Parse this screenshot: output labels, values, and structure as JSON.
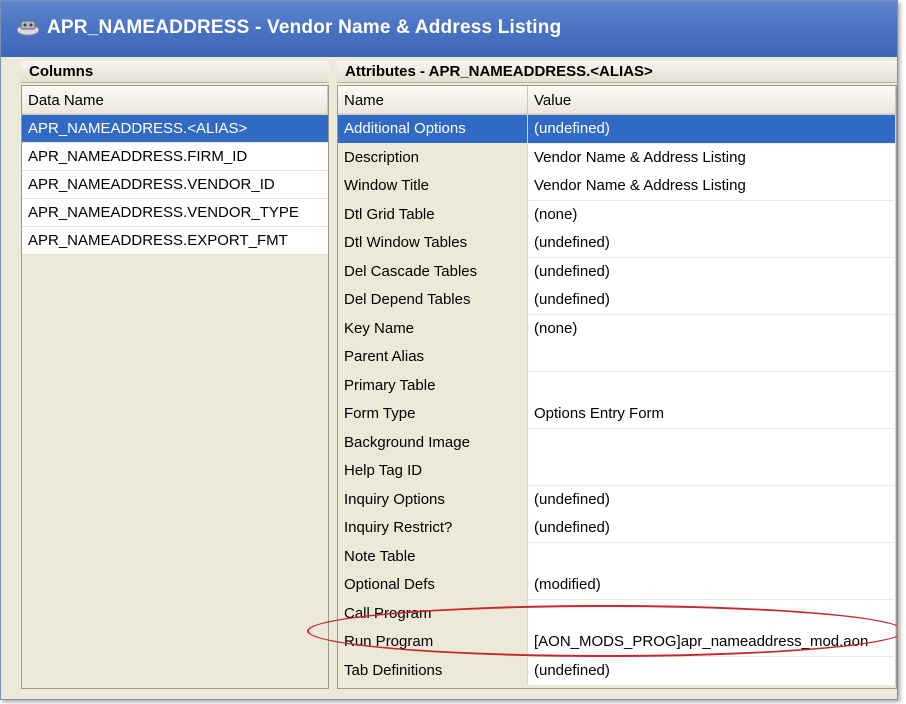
{
  "window": {
    "title": "APR_NAMEADDRESS - Vendor Name & Address Listing",
    "icon": "app-icon"
  },
  "columns_pane": {
    "header": "Columns",
    "column_header": "Data Name",
    "items": [
      {
        "label": "APR_NAMEADDRESS.<ALIAS>",
        "selected": true
      },
      {
        "label": "APR_NAMEADDRESS.FIRM_ID",
        "selected": false
      },
      {
        "label": "APR_NAMEADDRESS.VENDOR_ID",
        "selected": false
      },
      {
        "label": "APR_NAMEADDRESS.VENDOR_TYPE",
        "selected": false
      },
      {
        "label": "APR_NAMEADDRESS.EXPORT_FMT",
        "selected": false
      }
    ]
  },
  "attributes_pane": {
    "header": "Attributes - APR_NAMEADDRESS.<ALIAS>",
    "column_headers": {
      "name": "Name",
      "value": "Value"
    },
    "rows": [
      {
        "name": "Additional Options",
        "value": "(undefined)",
        "selected": true
      },
      {
        "name": "Description",
        "value": "Vendor Name & Address Listing"
      },
      {
        "name": "Window Title",
        "value": "Vendor Name & Address Listing"
      },
      {
        "name": "Dtl Grid Table",
        "value": "(none)"
      },
      {
        "name": "Dtl Window Tables",
        "value": "(undefined)"
      },
      {
        "name": "Del Cascade Tables",
        "value": "(undefined)"
      },
      {
        "name": "Del Depend Tables",
        "value": "(undefined)"
      },
      {
        "name": "Key Name",
        "value": "(none)"
      },
      {
        "name": "Parent Alias",
        "value": ""
      },
      {
        "name": "Primary Table",
        "value": ""
      },
      {
        "name": "Form Type",
        "value": "Options Entry Form"
      },
      {
        "name": "Background Image",
        "value": ""
      },
      {
        "name": "Help Tag ID",
        "value": ""
      },
      {
        "name": "Inquiry Options",
        "value": "(undefined)"
      },
      {
        "name": "Inquiry Restrict?",
        "value": "(undefined)"
      },
      {
        "name": "Note Table",
        "value": ""
      },
      {
        "name": "Optional Defs",
        "value": "(modified)"
      },
      {
        "name": "Call Program",
        "value": ""
      },
      {
        "name": "Run Program",
        "value": "[AON_MODS_PROG]apr_nameaddress_mod.aon",
        "highlighted": true
      },
      {
        "name": "Tab Definitions",
        "value": "(undefined)"
      }
    ]
  },
  "colors": {
    "titlebar": "#4b74c4",
    "selection": "#316ac5",
    "highlight_oval": "#c8282a"
  }
}
